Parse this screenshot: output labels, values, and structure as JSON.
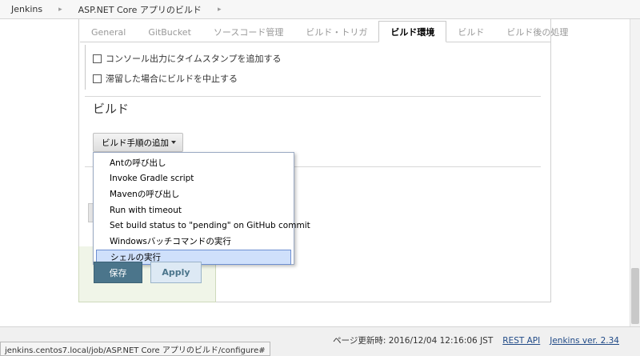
{
  "breadcrumb": {
    "items": [
      "Jenkins",
      "ASP.NET Core アプリのビルド"
    ],
    "separator": "▸"
  },
  "tabs": [
    {
      "label": "General",
      "active": false
    },
    {
      "label": "GitBucket",
      "active": false
    },
    {
      "label": "ソースコード管理",
      "active": false
    },
    {
      "label": "ビルド・トリガ",
      "active": false
    },
    {
      "label": "ビルド環境",
      "active": true
    },
    {
      "label": "ビルド",
      "active": false
    },
    {
      "label": "ビルド後の処理",
      "active": false
    }
  ],
  "build_env": {
    "options": [
      {
        "label": "コンソール出力にタイムスタンプを追加する",
        "checked": false
      },
      {
        "label": "滞留した場合にビルドを中止する",
        "checked": false
      }
    ]
  },
  "build": {
    "section_title": "ビルド",
    "add_step_label": "ビルド手順の追加",
    "menu": {
      "items": [
        "Antの呼び出し",
        "Invoke Gradle script",
        "Mavenの呼び出し",
        "Run with timeout",
        "Set build status to \"pending\" on GitHub commit",
        "Windowsバッチコマンドの実行",
        "シェルの実行"
      ],
      "highlighted": "シェルの実行"
    }
  },
  "actions": {
    "save_label": "保存",
    "apply_label": "Apply"
  },
  "footer": {
    "updated_label": "ページ更新時: 2016/12/04 12:16:06 JST",
    "rest_api": "REST API",
    "version": "Jenkins ver. 2.34"
  },
  "statusbar": {
    "url": "jenkins.centos7.local/job/ASP.NET Core アプリのビルド/configure#"
  },
  "colors": {
    "save_button": "#4b758b",
    "apply_button": "#dde9f4",
    "menu_highlight": "#cfe0fb",
    "link": "#204a87"
  }
}
